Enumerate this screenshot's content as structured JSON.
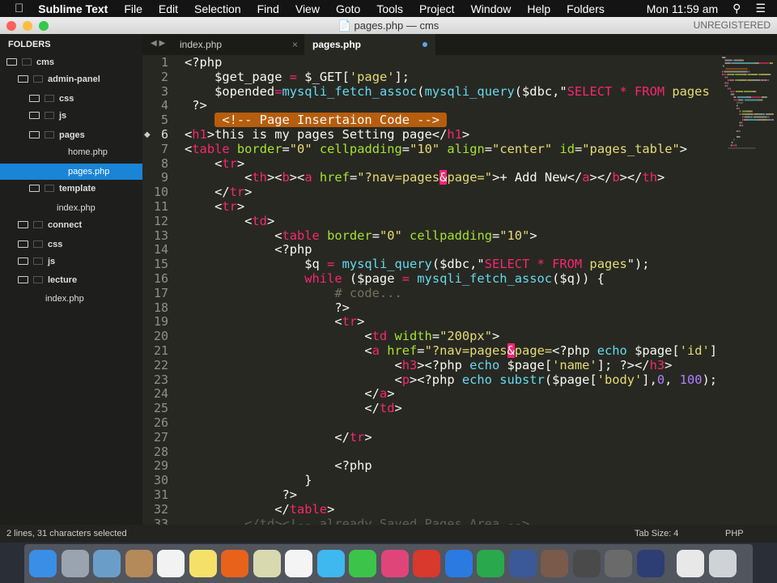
{
  "menubar": {
    "app": "Sublime Text",
    "items": [
      "File",
      "Edit",
      "Selection",
      "Find",
      "View",
      "Goto",
      "Tools",
      "Project",
      "Window",
      "Help",
      "Folders"
    ],
    "clock": "Mon 11:59 am"
  },
  "window": {
    "title": "pages.php — cms",
    "registration": "UNREGISTERED"
  },
  "sidebar": {
    "header": "FOLDERS",
    "items": [
      {
        "label": "cms",
        "type": "folder-open",
        "level": 0
      },
      {
        "label": "admin-panel",
        "type": "folder-open",
        "level": 1
      },
      {
        "label": "css",
        "type": "folder",
        "level": 2
      },
      {
        "label": "js",
        "type": "folder",
        "level": 2
      },
      {
        "label": "pages",
        "type": "folder-open",
        "level": 2
      },
      {
        "label": "home.php",
        "type": "file",
        "level": 3
      },
      {
        "label": "pages.php",
        "type": "file",
        "level": 3,
        "selected": true
      },
      {
        "label": "template",
        "type": "folder",
        "level": 2
      },
      {
        "label": "index.php",
        "type": "file",
        "level": 2
      },
      {
        "label": "connect",
        "type": "folder",
        "level": 1
      },
      {
        "label": "css",
        "type": "folder",
        "level": 1
      },
      {
        "label": "js",
        "type": "folder",
        "level": 1
      },
      {
        "label": "lecture",
        "type": "folder",
        "level": 1
      },
      {
        "label": "index.php",
        "type": "file",
        "level": 1
      }
    ]
  },
  "tabs": [
    {
      "label": "index.php",
      "active": false
    },
    {
      "label": "pages.php",
      "active": true,
      "modified": true
    }
  ],
  "code": [
    [
      [
        "p",
        "<?php"
      ]
    ],
    [
      [
        "p",
        "    $get_page "
      ],
      [
        "k",
        "="
      ],
      [
        "p",
        " $_GET["
      ],
      [
        "s",
        "'page'"
      ],
      [
        "p",
        "];"
      ]
    ],
    [
      [
        "p",
        "    $opended"
      ],
      [
        "k",
        "="
      ],
      [
        "f",
        "mysqli_fetch_assoc"
      ],
      [
        "p",
        "("
      ],
      [
        "f",
        "mysqli_query"
      ],
      [
        "p",
        "($dbc,\""
      ],
      [
        "k",
        "SELECT * FROM"
      ],
      [
        "s",
        " pages"
      ]
    ],
    [
      [
        "p",
        " ?>"
      ]
    ],
    [
      [
        "p",
        "    "
      ],
      [
        "hl",
        " <!-- Page Insertaion Code --> "
      ]
    ],
    [
      [
        "p",
        "<"
      ],
      [
        "t",
        "h1"
      ],
      [
        "p",
        ">this is my pages Setting page</"
      ],
      [
        "t",
        "h1"
      ],
      [
        "p",
        ">"
      ]
    ],
    [
      [
        "p",
        "<"
      ],
      [
        "t",
        "table"
      ],
      [
        "a",
        " border"
      ],
      [
        "p",
        "="
      ],
      [
        "s",
        "\"0\""
      ],
      [
        "a",
        " cellpadding"
      ],
      [
        "p",
        "="
      ],
      [
        "s",
        "\"10\""
      ],
      [
        "a",
        " align"
      ],
      [
        "p",
        "="
      ],
      [
        "s",
        "\"center\""
      ],
      [
        "a",
        " id"
      ],
      [
        "p",
        "="
      ],
      [
        "s",
        "\"pages_table\""
      ],
      [
        "p",
        ">"
      ]
    ],
    [
      [
        "p",
        "    <"
      ],
      [
        "t",
        "tr"
      ],
      [
        "p",
        ">"
      ]
    ],
    [
      [
        "p",
        "        <"
      ],
      [
        "t",
        "th"
      ],
      [
        "p",
        "><"
      ],
      [
        "t",
        "b"
      ],
      [
        "p",
        "><"
      ],
      [
        "t",
        "a"
      ],
      [
        "a",
        " href"
      ],
      [
        "p",
        "="
      ],
      [
        "s",
        "\"?nav=pages"
      ],
      [
        "amp",
        "&"
      ],
      [
        "s",
        "page=\""
      ],
      [
        "p",
        ">+ Add New</"
      ],
      [
        "t",
        "a"
      ],
      [
        "p",
        "></"
      ],
      [
        "t",
        "b"
      ],
      [
        "p",
        "></"
      ],
      [
        "t",
        "th"
      ],
      [
        "p",
        ">"
      ]
    ],
    [
      [
        "p",
        "    </"
      ],
      [
        "t",
        "tr"
      ],
      [
        "p",
        ">"
      ]
    ],
    [
      [
        "p",
        "    <"
      ],
      [
        "t",
        "tr"
      ],
      [
        "p",
        ">"
      ]
    ],
    [
      [
        "p",
        "        <"
      ],
      [
        "t",
        "td"
      ],
      [
        "p",
        ">"
      ]
    ],
    [
      [
        "p",
        "            <"
      ],
      [
        "t",
        "table"
      ],
      [
        "a",
        " border"
      ],
      [
        "p",
        "="
      ],
      [
        "s",
        "\"0\""
      ],
      [
        "a",
        " cellpadding"
      ],
      [
        "p",
        "="
      ],
      [
        "s",
        "\"10\""
      ],
      [
        "p",
        ">"
      ]
    ],
    [
      [
        "p",
        "            <?php"
      ]
    ],
    [
      [
        "p",
        "                $q "
      ],
      [
        "k",
        "="
      ],
      [
        "f",
        " mysqli_query"
      ],
      [
        "p",
        "($dbc,\""
      ],
      [
        "k",
        "SELECT * FROM"
      ],
      [
        "s",
        " pages"
      ],
      [
        "p",
        "\");"
      ]
    ],
    [
      [
        "k",
        "                while"
      ],
      [
        "p",
        " ($page "
      ],
      [
        "k",
        "="
      ],
      [
        "f",
        " mysqli_fetch_assoc"
      ],
      [
        "p",
        "($q)) {"
      ]
    ],
    [
      [
        "c",
        "                    # code..."
      ]
    ],
    [
      [
        "p",
        "                    ?>"
      ]
    ],
    [
      [
        "p",
        "                    <"
      ],
      [
        "t",
        "tr"
      ],
      [
        "p",
        ">"
      ]
    ],
    [
      [
        "p",
        "                        <"
      ],
      [
        "t",
        "td"
      ],
      [
        "a",
        " width"
      ],
      [
        "p",
        "="
      ],
      [
        "s",
        "\"200px\""
      ],
      [
        "p",
        ">"
      ]
    ],
    [
      [
        "p",
        "                        <"
      ],
      [
        "t",
        "a"
      ],
      [
        "a",
        " href"
      ],
      [
        "p",
        "="
      ],
      [
        "s",
        "\"?nav=pages"
      ],
      [
        "amp",
        "&"
      ],
      [
        "s",
        "page="
      ],
      [
        "p",
        "<?php "
      ],
      [
        "f",
        "echo"
      ],
      [
        "p",
        " $page["
      ],
      [
        "s",
        "'id'"
      ],
      [
        "p",
        "]"
      ]
    ],
    [
      [
        "p",
        "                            <"
      ],
      [
        "t",
        "h3"
      ],
      [
        "p",
        "><?php "
      ],
      [
        "f",
        "echo"
      ],
      [
        "p",
        " $page["
      ],
      [
        "s",
        "'name'"
      ],
      [
        "p",
        "]; ?></"
      ],
      [
        "t",
        "h3"
      ],
      [
        "p",
        ">"
      ]
    ],
    [
      [
        "p",
        "                            <"
      ],
      [
        "t",
        "p"
      ],
      [
        "p",
        "><?php "
      ],
      [
        "f",
        "echo substr"
      ],
      [
        "p",
        "($page["
      ],
      [
        "s",
        "'body'"
      ],
      [
        "p",
        "],"
      ],
      [
        "n",
        "0"
      ],
      [
        "p",
        ", "
      ],
      [
        "n",
        "100"
      ],
      [
        "p",
        ");"
      ]
    ],
    [
      [
        "p",
        "                        </"
      ],
      [
        "t",
        "a"
      ],
      [
        "p",
        ">"
      ]
    ],
    [
      [
        "p",
        "                        </"
      ],
      [
        "t",
        "td"
      ],
      [
        "p",
        ">"
      ]
    ],
    [
      [
        "p",
        ""
      ]
    ],
    [
      [
        "p",
        "                    </"
      ],
      [
        "t",
        "tr"
      ],
      [
        "p",
        ">"
      ]
    ],
    [
      [
        "p",
        ""
      ]
    ],
    [
      [
        "p",
        "                    <?php"
      ]
    ],
    [
      [
        "p",
        "                }"
      ]
    ],
    [
      [
        "p",
        "             ?>"
      ]
    ],
    [
      [
        "p",
        "            </"
      ],
      [
        "t",
        "table"
      ],
      [
        "p",
        ">"
      ]
    ],
    [
      [
        "dim",
        "        </td><!-- already Saved Pages Area -->"
      ]
    ]
  ],
  "status": {
    "selection": "2 lines, 31 characters selected",
    "tab_size": "Tab Size: 4",
    "syntax": "PHP"
  },
  "dock": [
    "finder",
    "launchpad",
    "preview",
    "contacts",
    "reminders",
    "notes",
    "firefox",
    "image-capture",
    "photos",
    "messages",
    "facetime",
    "itunes",
    "wps-presentation",
    "wps-writer",
    "wps-spreadsheet",
    "facebook",
    "user-photo",
    "sublime-text",
    "mamp",
    "quicktime",
    "document",
    "trash"
  ]
}
